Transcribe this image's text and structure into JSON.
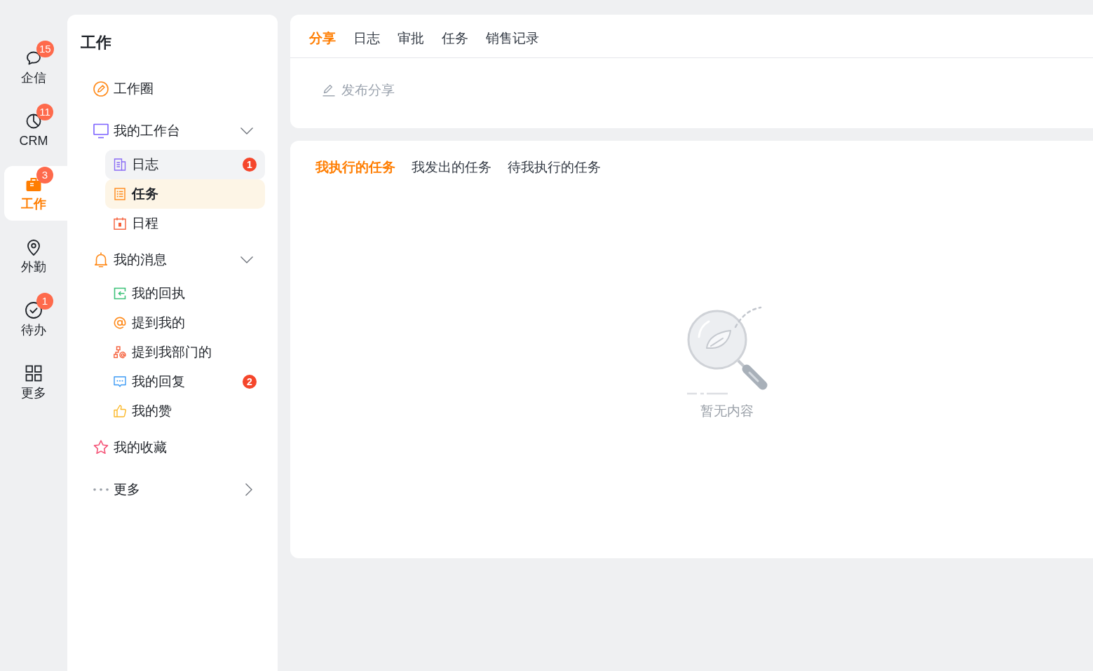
{
  "rail": {
    "items": [
      {
        "label": "企信",
        "badge": "15",
        "selected": false
      },
      {
        "label": "CRM",
        "badge": "11",
        "selected": false
      },
      {
        "label": "工作",
        "badge": "3",
        "selected": true
      },
      {
        "label": "外勤",
        "selected": false
      },
      {
        "label": "待办",
        "badge": "1",
        "selected": false
      },
      {
        "label": "更多",
        "selected": false
      }
    ]
  },
  "sidebar": {
    "title": "工作",
    "items": [
      {
        "kind": "link",
        "label": "工作圈",
        "selected": false
      },
      {
        "kind": "group",
        "label": "我的工作台",
        "selected": false,
        "expanded": true,
        "children": [
          {
            "label": "日志",
            "badge": "1",
            "selected": false,
            "hovered": true
          },
          {
            "label": "任务",
            "selected": true,
            "hovered": false
          },
          {
            "label": "日程",
            "selected": false,
            "hovered": false
          }
        ]
      },
      {
        "kind": "group",
        "label": "我的消息",
        "selected": false,
        "expanded": true,
        "children": [
          {
            "label": "我的回执",
            "selected": false,
            "hovered": false
          },
          {
            "label": "提到我的",
            "selected": false,
            "hovered": false
          },
          {
            "label": "提到我部门的",
            "selected": false,
            "hovered": false
          },
          {
            "label": "我的回复",
            "badge": "2",
            "selected": false,
            "hovered": false
          },
          {
            "label": "我的赞",
            "selected": false,
            "hovered": false
          }
        ]
      },
      {
        "kind": "link",
        "label": "我的收藏",
        "selected": false
      },
      {
        "kind": "group",
        "label": "更多",
        "selected": false,
        "expanded": false
      }
    ]
  },
  "main": {
    "tabs": [
      {
        "label": "分享",
        "selected": true
      },
      {
        "label": "日志",
        "selected": false
      },
      {
        "label": "审批",
        "selected": false
      },
      {
        "label": "任务",
        "selected": false
      },
      {
        "label": "销售记录",
        "selected": false
      }
    ],
    "post_button": {
      "label": "发布分享"
    },
    "task_tabs": [
      {
        "label": "我执行的任务",
        "selected": true
      },
      {
        "label": "我发出的任务",
        "selected": false
      },
      {
        "label": "待我执行的任务",
        "selected": false
      }
    ],
    "empty_state": {
      "text": "暂无内容"
    }
  }
}
